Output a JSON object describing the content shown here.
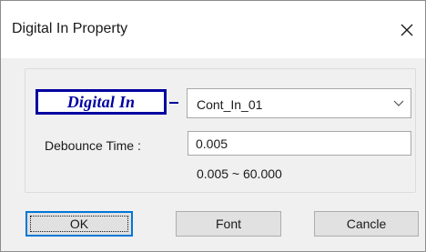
{
  "dialog": {
    "title": "Digital In Property",
    "close_icon": "close-icon"
  },
  "preview": {
    "label": "Digital In",
    "color": "#0000a0"
  },
  "contact_select": {
    "value": "Cont_In_01",
    "arrow_icon": "chevron-down-icon"
  },
  "debounce": {
    "label": "Debounce Time :",
    "value": "0.005",
    "range": "0.005 ~ 60.000"
  },
  "buttons": {
    "ok": "OK",
    "font": "Font",
    "cancel": "Cancle"
  }
}
